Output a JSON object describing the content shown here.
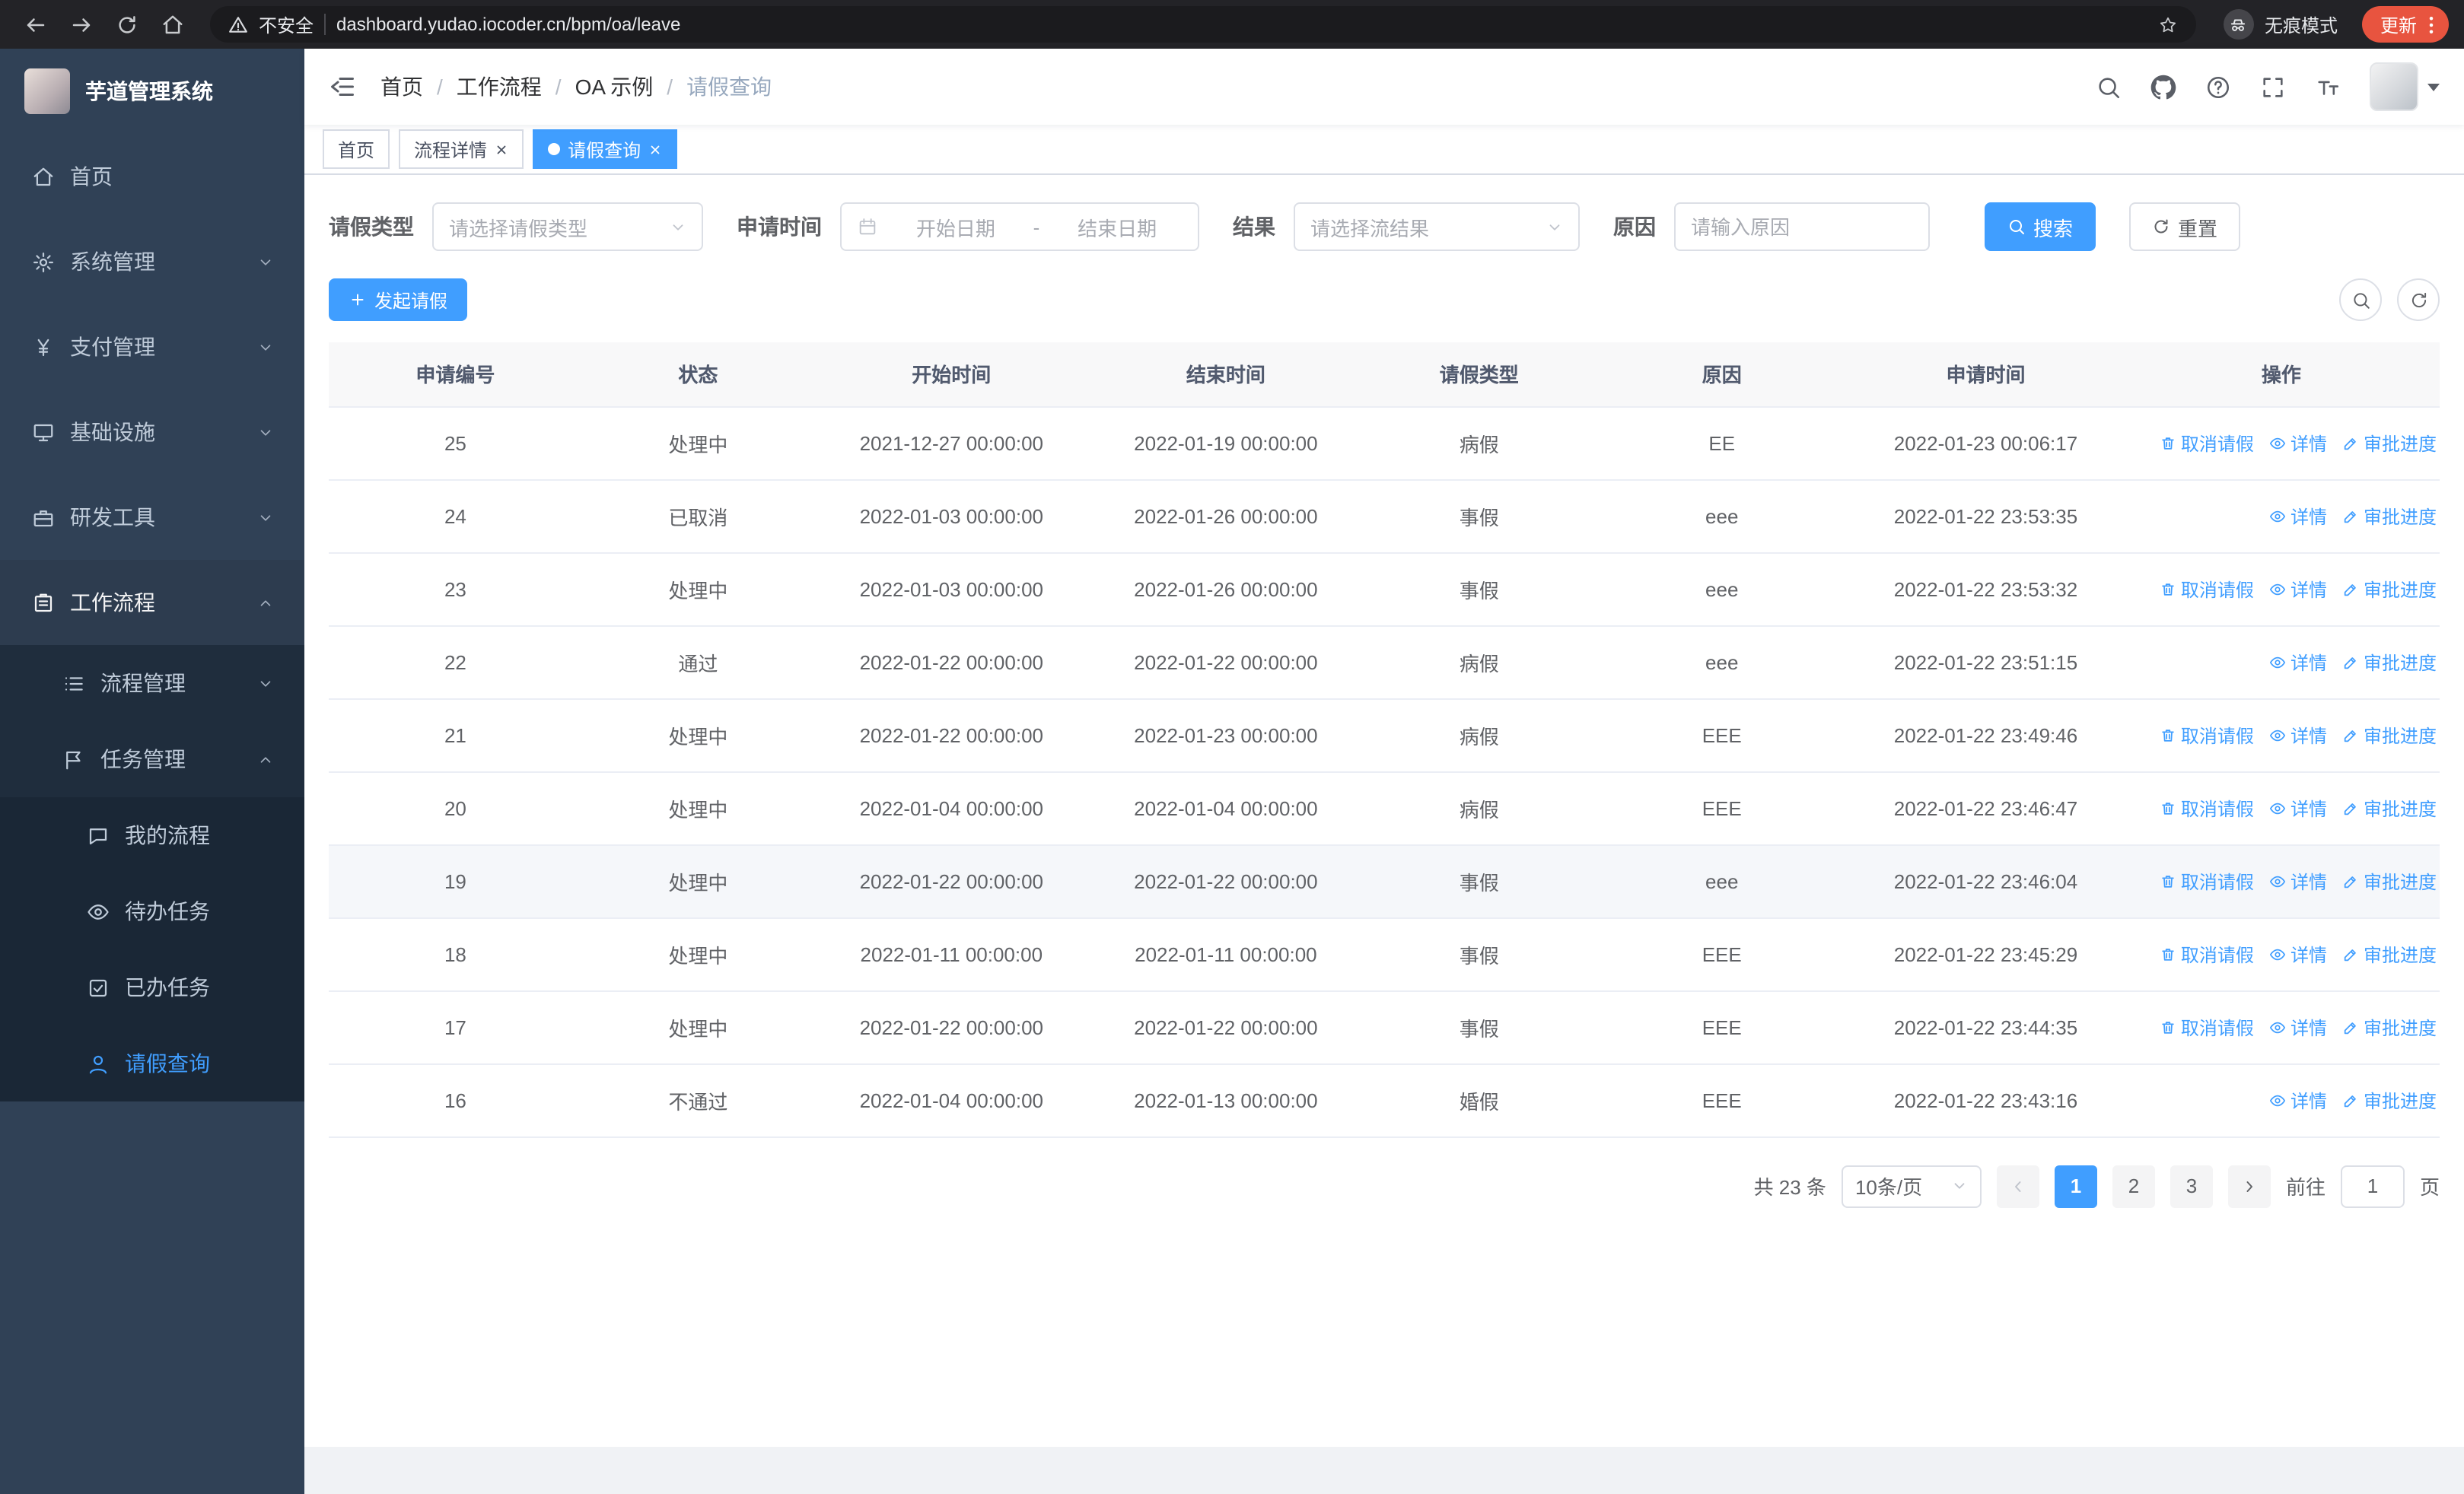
{
  "browser": {
    "security_label": "不安全",
    "url": "dashboard.yudao.iocoder.cn/bpm/oa/leave",
    "incognito_label": "无痕模式",
    "update_label": "更新"
  },
  "sidebar": {
    "logo_title": "芋道管理系统",
    "items": [
      {
        "label": "首页",
        "icon": "home-icon"
      },
      {
        "label": "系统管理",
        "icon": "gear-icon"
      },
      {
        "label": "支付管理",
        "icon": "yen-icon"
      },
      {
        "label": "基础设施",
        "icon": "monitor-icon"
      },
      {
        "label": "研发工具",
        "icon": "briefcase-icon"
      },
      {
        "label": "工作流程",
        "icon": "workflow-icon",
        "expanded": true
      }
    ],
    "workflow_children": [
      {
        "label": "流程管理",
        "icon": "list-icon"
      },
      {
        "label": "任务管理",
        "icon": "flag-icon",
        "expanded": true
      }
    ],
    "task_children": [
      {
        "label": "我的流程",
        "icon": "chat-icon"
      },
      {
        "label": "待办任务",
        "icon": "eye-icon"
      },
      {
        "label": "已办任务",
        "icon": "check-icon"
      },
      {
        "label": "请假查询",
        "icon": "user-icon",
        "active": true
      }
    ]
  },
  "header": {
    "breadcrumb": [
      "首页",
      "工作流程",
      "OA 示例",
      "请假查询"
    ]
  },
  "tabs": [
    {
      "label": "首页",
      "closable": false,
      "active": false
    },
    {
      "label": "流程详情",
      "closable": true,
      "active": false
    },
    {
      "label": "请假查询",
      "closable": true,
      "active": true
    }
  ],
  "filters": {
    "leave_type_label": "请假类型",
    "leave_type_placeholder": "请选择请假类型",
    "apply_time_label": "申请时间",
    "start_placeholder": "开始日期",
    "range_separator": "-",
    "end_placeholder": "结束日期",
    "result_label": "结果",
    "result_placeholder": "请选择流结果",
    "reason_label": "原因",
    "reason_placeholder": "请输入原因",
    "search_label": "搜索",
    "reset_label": "重置"
  },
  "toolbar": {
    "create_label": "发起请假"
  },
  "table": {
    "columns": [
      "申请编号",
      "状态",
      "开始时间",
      "结束时间",
      "请假类型",
      "原因",
      "申请时间",
      "操作"
    ],
    "action_labels": {
      "cancel": "取消请假",
      "detail": "详情",
      "progress": "审批进度"
    },
    "action_icons": {
      "cancel": "delete-icon",
      "detail": "eye-icon",
      "progress": "edit-icon"
    },
    "rows": [
      {
        "id": "25",
        "status": "处理中",
        "start": "2021-12-27 00:00:00",
        "end": "2022-01-19 00:00:00",
        "type": "病假",
        "reason": "EE",
        "apply_time": "2022-01-23 00:06:17",
        "actions": [
          "cancel",
          "detail",
          "progress"
        ]
      },
      {
        "id": "24",
        "status": "已取消",
        "start": "2022-01-03 00:00:00",
        "end": "2022-01-26 00:00:00",
        "type": "事假",
        "reason": "eee",
        "apply_time": "2022-01-22 23:53:35",
        "actions": [
          "detail",
          "progress"
        ]
      },
      {
        "id": "23",
        "status": "处理中",
        "start": "2022-01-03 00:00:00",
        "end": "2022-01-26 00:00:00",
        "type": "事假",
        "reason": "eee",
        "apply_time": "2022-01-22 23:53:32",
        "actions": [
          "cancel",
          "detail",
          "progress"
        ]
      },
      {
        "id": "22",
        "status": "通过",
        "start": "2022-01-22 00:00:00",
        "end": "2022-01-22 00:00:00",
        "type": "病假",
        "reason": "eee",
        "apply_time": "2022-01-22 23:51:15",
        "actions": [
          "detail",
          "progress"
        ]
      },
      {
        "id": "21",
        "status": "处理中",
        "start": "2022-01-22 00:00:00",
        "end": "2022-01-23 00:00:00",
        "type": "病假",
        "reason": "EEE",
        "apply_time": "2022-01-22 23:49:46",
        "actions": [
          "cancel",
          "detail",
          "progress"
        ]
      },
      {
        "id": "20",
        "status": "处理中",
        "start": "2022-01-04 00:00:00",
        "end": "2022-01-04 00:00:00",
        "type": "病假",
        "reason": "EEE",
        "apply_time": "2022-01-22 23:46:47",
        "actions": [
          "cancel",
          "detail",
          "progress"
        ]
      },
      {
        "id": "19",
        "status": "处理中",
        "start": "2022-01-22 00:00:00",
        "end": "2022-01-22 00:00:00",
        "type": "事假",
        "reason": "eee",
        "apply_time": "2022-01-22 23:46:04",
        "actions": [
          "cancel",
          "detail",
          "progress"
        ],
        "highlighted": true
      },
      {
        "id": "18",
        "status": "处理中",
        "start": "2022-01-11 00:00:00",
        "end": "2022-01-11 00:00:00",
        "type": "事假",
        "reason": "EEE",
        "apply_time": "2022-01-22 23:45:29",
        "actions": [
          "cancel",
          "detail",
          "progress"
        ]
      },
      {
        "id": "17",
        "status": "处理中",
        "start": "2022-01-22 00:00:00",
        "end": "2022-01-22 00:00:00",
        "type": "事假",
        "reason": "EEE",
        "apply_time": "2022-01-22 23:44:35",
        "actions": [
          "cancel",
          "detail",
          "progress"
        ]
      },
      {
        "id": "16",
        "status": "不通过",
        "start": "2022-01-04 00:00:00",
        "end": "2022-01-13 00:00:00",
        "type": "婚假",
        "reason": "EEE",
        "apply_time": "2022-01-22 23:43:16",
        "actions": [
          "detail",
          "progress"
        ]
      }
    ]
  },
  "pagination": {
    "total_label": "共 23 条",
    "page_size_label": "10条/页",
    "pages": [
      "1",
      "2",
      "3"
    ],
    "active_page": "1",
    "goto_label": "前往",
    "goto_value": "1",
    "page_unit_label": "页"
  },
  "colors": {
    "accent": "#409eff",
    "sidebar_bg": "#304156",
    "submenu_bg": "#1f2d3d",
    "chrome_bg": "#232327"
  }
}
